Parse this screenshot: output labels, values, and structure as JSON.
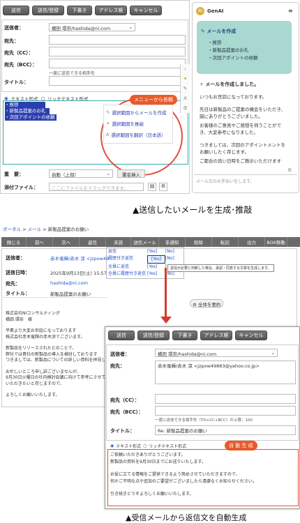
{
  "compose_top": {
    "toolbar": [
      "送信",
      "送信/登録",
      "下書き",
      "アドレス帳",
      "キャンセル"
    ],
    "labels": {
      "to": "送信者：",
      "addr": "宛先：",
      "cc": "宛先（CC）：",
      "bcc": "宛先（BCC）：",
      "title": "タイトル："
    },
    "sender_value": "橋田 環奈/hashida@ni.com",
    "bcc_note": "一度に送信できる相手先",
    "format_text": "テキスト形式",
    "format_rich": "リッチテキスト形式",
    "body_lines": [
      "・挨拶",
      "・新製品提案のお礼",
      "・次回アポイントの依頼"
    ],
    "menu_callout": "メニューから依頼",
    "ai_menu": [
      "選択範囲からメールを作成",
      "選択範囲を推敲",
      "選択範囲を翻訳（日本語）"
    ],
    "importance_label": "重　要：",
    "importance_value": "自動（上部）",
    "signature_button": "署名挿入",
    "attach_label": "添付ファイル：",
    "attach_placeholder": "ここにファイルをドラッグできます。"
  },
  "genai": {
    "title": "GenAI",
    "request_title": "メールを作成",
    "request_items": [
      "・挨拶",
      "・新製品提案のお礼",
      "・次回アポイントの依頼"
    ],
    "response_title": "メールを作成しました。",
    "response_lines": [
      "いつもお世話になっております。",
      "先日は新製品のご提案の機会をいただき、誠にありがとうございました。",
      "お客様のご意見やご感想を伺うことができ、大変参考になりました。",
      "つきましては、次回のアポイントメントをお願いしたく存じます。",
      "ご都合の良い日時をご教示いただけます"
    ],
    "input_placeholder": "メール文のお手伝いをします。"
  },
  "caption1": "▲送信したいメールを生成･推敲",
  "viewer": {
    "breadcrumb": [
      "ポータル",
      "メール",
      "新製品提案のお願い"
    ],
    "toolbar": [
      "閉じる",
      "前へ",
      "次へ",
      "返信",
      "未読",
      "送信メール",
      "非通知",
      "削除",
      "転記",
      "出力",
      "BOX移動"
    ],
    "reply_menu": [
      {
        "label": "返信",
        "yes": "[Yes]",
        "no": "[No]"
      },
      {
        "label": "履歴付き返信",
        "yes": "[Yes]",
        "no": "[No]"
      },
      {
        "label": "全員に返信",
        "yes": "[Yes]",
        "no": "[No]"
      },
      {
        "label": "全員に履歴付き返信",
        "yes": "[Yes]",
        "no": "[No]"
      }
    ],
    "tooltip": "返信が必要と判断した場合、承認・同意する文章を生成します。",
    "labels": {
      "sender": "送信者：",
      "date": "送信日時：",
      "addr": "宛先：",
      "title": "タイトル："
    },
    "sender_value": "赤木竜輝/赤木 涼 <jzpow49",
    "date_value": "2025年9月13日(土) 15:57",
    "addr_value": "hashida@ni.com",
    "title_value": "新製品提案のお願い",
    "summary_button": "全体を要約",
    "body_lines": [
      "株式会社NIコンサルティング",
      "橋田 環奈　様",
      "",
      "平素より大変お世話になっております",
      "株式会社赤木竜輝の赤木涼でございます。",
      "",
      "新製品をリリースされたとのことで、",
      "弊社では貴社の新製品の導入を検討しております",
      "つきましては、新製品についての詳しい資料を拝見し",
      "",
      "お忙しいところ申し訳ございませんが、",
      "9月30日火曜日の社内検討会議に向けて参考にさせて",
      "いただきたいと存じますので、",
      "",
      "よろしくお願いいたします。"
    ]
  },
  "reply": {
    "toolbar": [
      "送信",
      "送信/登録",
      "下書き",
      "アドレス帳",
      "キャンセル"
    ],
    "labels": {
      "sender": "送信者：",
      "addr": "宛先：",
      "cc": "宛先（CC）：",
      "bcc": "宛先（BCC）：",
      "title": "タイトル："
    },
    "sender_value": "橋田 環奈/hashida@ni.com",
    "addr_value": "赤木竜輝/赤木 涼 <jzpow49883@yahoo.co.jp>",
    "bcc_note": "一度に送信できる相手先（TO+CC+BCC）の上限：100",
    "title_value": "Re: 新製品提案のお願い",
    "format_text": "テキスト形式",
    "format_rich": "リッチテキスト形式",
    "auto_badge": "自 動 生 成",
    "body_lines": [
      "ご依頼いただきありがとうございます。",
      "新製品の資料を9月30日までにお送りいたします。",
      "",
      "お役に立てる情報をご提供できるよう努めさせていただきますので、",
      "何かご不明な点や追加のご要望がございましたら遠慮なくお知らせください。",
      "",
      "引き続きどうぞよろしくお願いいたします。"
    ]
  },
  "caption2": "▲受信メールから返信文を自動生成"
}
